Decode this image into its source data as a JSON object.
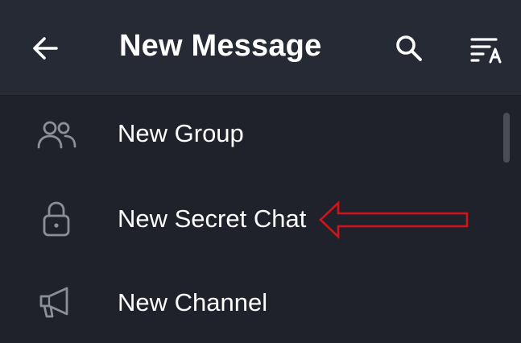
{
  "header": {
    "title": "New Message",
    "back_icon": "arrow-left-icon",
    "search_icon": "search-icon",
    "sort_icon": "sort-alpha-icon"
  },
  "menu": {
    "items": [
      {
        "label": "New Group",
        "icon": "people-icon"
      },
      {
        "label": "New Secret Chat",
        "icon": "lock-icon"
      },
      {
        "label": "New Channel",
        "icon": "megaphone-icon"
      }
    ]
  },
  "colors": {
    "background": "#1f222b",
    "header_background": "#262a34",
    "icon_gray": "#8a8f99",
    "text": "#ffffff",
    "annotation_arrow": "#d0141a"
  }
}
